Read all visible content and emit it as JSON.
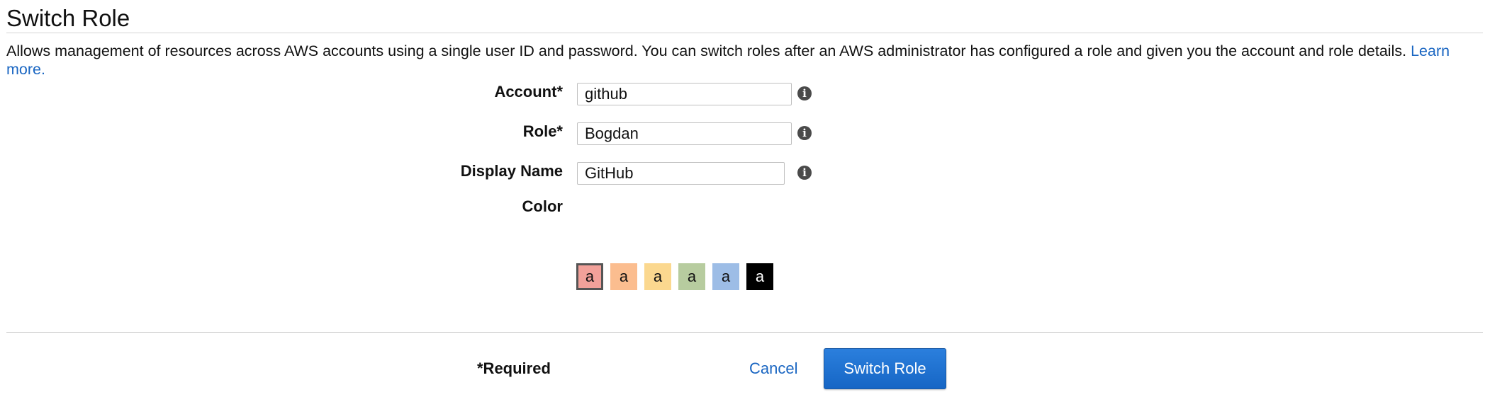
{
  "page": {
    "title": "Switch Role",
    "description": "Allows management of resources across AWS accounts using a single user ID and password. You can switch roles after an AWS administrator has configured a role and given you the account and role details.",
    "learn_more_label": "Learn more."
  },
  "form": {
    "account": {
      "label": "Account*",
      "value": "github",
      "info_icon": "info-icon"
    },
    "role": {
      "label": "Role*",
      "value": "Bogdan",
      "info_icon": "info-icon"
    },
    "display_name": {
      "label": "Display Name",
      "value": "GitHub",
      "info_icon": "info-icon"
    },
    "color": {
      "label": "Color",
      "selected_index": 0,
      "swatches": [
        {
          "letter": "a",
          "color": "#f2a19a"
        },
        {
          "letter": "a",
          "color": "#fbbd8f"
        },
        {
          "letter": "a",
          "color": "#fbd88f"
        },
        {
          "letter": "a",
          "color": "#b7cc9f"
        },
        {
          "letter": "a",
          "color": "#9dbde6"
        },
        {
          "letter": "a",
          "color": "#000000"
        }
      ]
    }
  },
  "footer": {
    "required_note": "*Required",
    "cancel_label": "Cancel",
    "submit_label": "Switch Role"
  },
  "colors": {
    "link": "#1a66c2",
    "primary_button": "#1666c5"
  }
}
